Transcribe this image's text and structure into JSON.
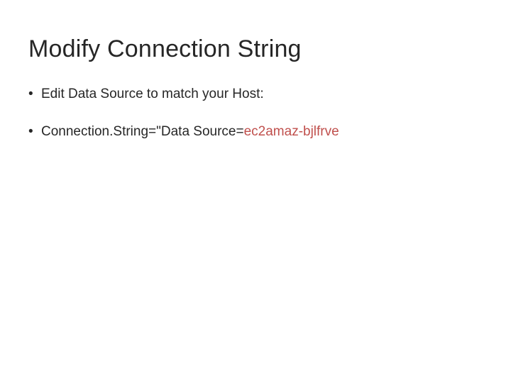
{
  "title": "Modify Connection String",
  "bullets": [
    {
      "text": "Edit Data Source to match your Host:"
    },
    {
      "prefix": "Connection.String=\"Data Source=",
      "highlight": "ec2amaz-bjlfrve"
    }
  ]
}
